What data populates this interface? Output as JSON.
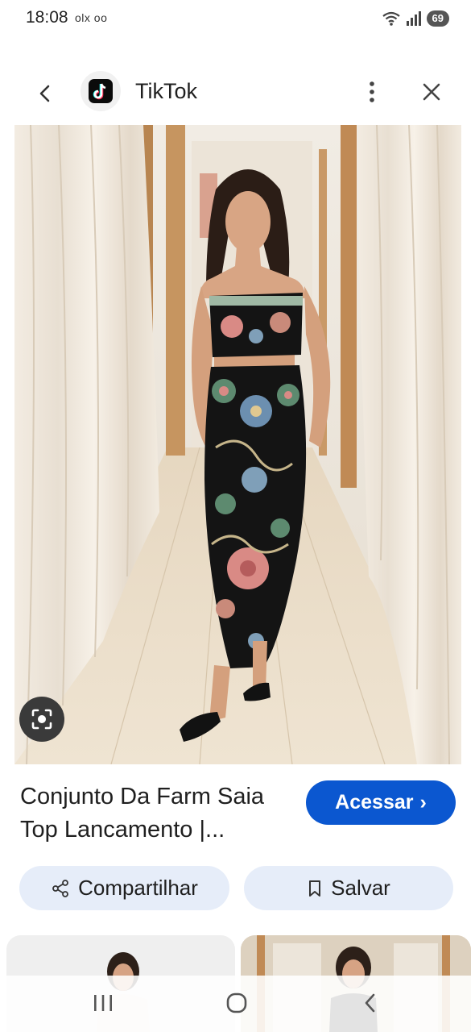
{
  "status_bar": {
    "time": "18:08",
    "extra_icons": "olx ᴏᴏ",
    "battery": "69"
  },
  "header": {
    "app_title": "TikTok"
  },
  "result": {
    "title": "Conjunto Da Farm Saia Top Lancamento |...",
    "visit_label": "Acessar",
    "visit_chevron": "›"
  },
  "actions": {
    "share_label": "Compartilhar",
    "save_label": "Salvar"
  },
  "icons": {
    "back": "chevron-left-icon",
    "more": "more-vertical-icon",
    "close": "close-icon",
    "lens": "lens-icon",
    "share": "share-icon",
    "save": "bookmark-icon"
  },
  "colors": {
    "accent": "#0b57d0",
    "pill_bg": "#e6edf9",
    "text": "#1f1f1f"
  }
}
